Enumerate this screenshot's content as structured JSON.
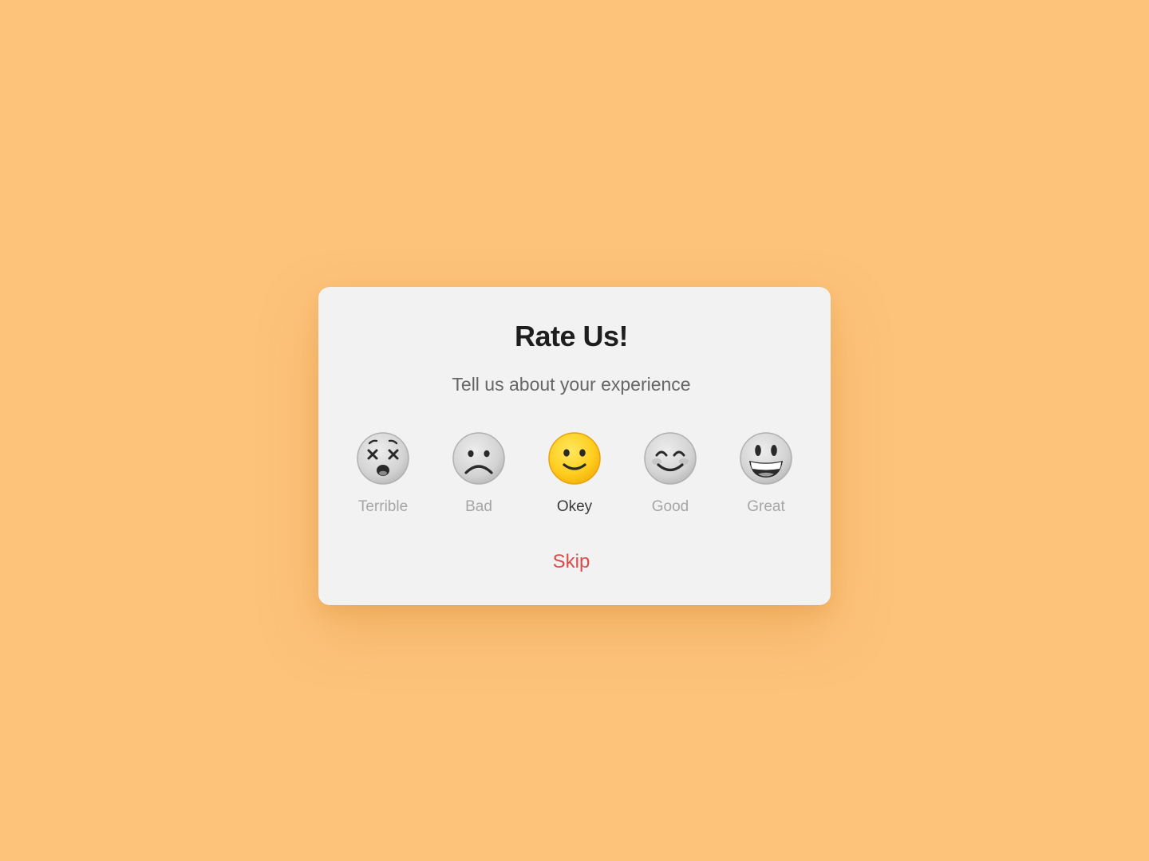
{
  "dialog": {
    "title": "Rate Us!",
    "subtitle": "Tell us about your experience",
    "skip_label": "Skip"
  },
  "ratings": [
    {
      "label": "Terrible",
      "icon": "dizzy-face-icon",
      "selected": false
    },
    {
      "label": "Bad",
      "icon": "frowning-face-icon",
      "selected": false
    },
    {
      "label": "Okey",
      "icon": "slightly-smiling-face-icon",
      "selected": true
    },
    {
      "label": "Good",
      "icon": "smiling-eyes-face-icon",
      "selected": false
    },
    {
      "label": "Great",
      "icon": "grinning-face-icon",
      "selected": false
    }
  ],
  "colors": {
    "background": "#FDC37B",
    "dialog": "#F2F2F2",
    "title": "#1E1E1E",
    "subtitle": "#666666",
    "selected_face": "#FFCC1A",
    "inactive_face": "#D9D9D9",
    "skip": "#D94C4C"
  }
}
